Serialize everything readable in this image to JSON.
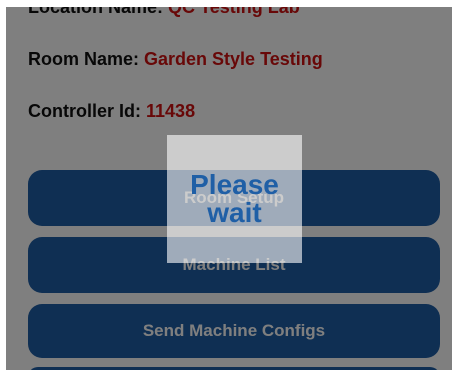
{
  "info": {
    "location_label": "Location Name:",
    "location_value": "QC Testing Lab",
    "room_label": "Room Name:",
    "room_value": "Garden Style Testing",
    "controller_label": "Controller Id:",
    "controller_value": "11438"
  },
  "buttons": {
    "room_setup": "Room Setup",
    "machine_list": "Machine List",
    "send_machine_configs": "Send Machine Configs"
  },
  "loading": {
    "message": "Please wait"
  },
  "colors": {
    "button_blue": "#1f5fa6",
    "value_red": "#d01010",
    "overlay": "rgba(0,0,0,0.5)"
  }
}
